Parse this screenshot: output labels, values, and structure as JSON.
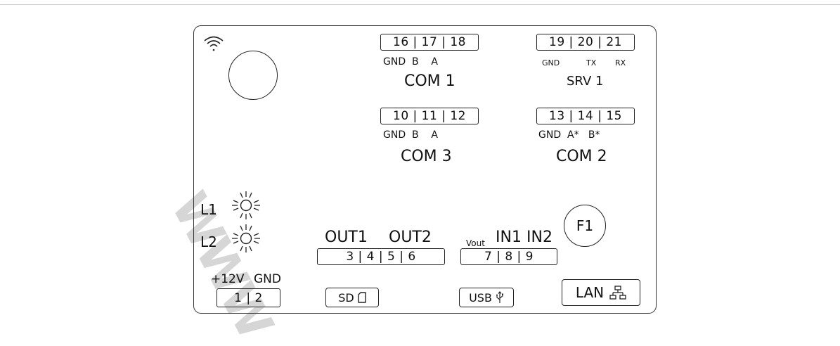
{
  "terminals": {
    "com1_pins": "16 | 17 | 18",
    "srv1_pins": "19 | 20 | 21",
    "com3_pins": "10 | 11 | 12",
    "com2_pins": "13 | 14 | 15",
    "out_pins": "3 | 4 | 5 | 6",
    "in_pins": "7 | 8 | 9",
    "power_pins": "1 | 2"
  },
  "signals": {
    "com1": "GND  B    A",
    "srv1": [
      "GND",
      "TX",
      "RX"
    ],
    "com3": "GND  B    A",
    "com2": "GND  A*   B*"
  },
  "ports": {
    "com1": "COM 1",
    "srv1": "SRV 1",
    "com3": "COM 3",
    "com2": "COM 2"
  },
  "leds": {
    "l1": "L1",
    "l2": "L2"
  },
  "outputs": {
    "out1": "OUT1",
    "out2": "OUT2"
  },
  "inputs": {
    "vout": "Vout",
    "in1": "IN1",
    "in2": "IN2"
  },
  "power": {
    "v12": "+12V",
    "gnd": "GND"
  },
  "function_button": "F1",
  "sd_label": "SD",
  "usb_label": "USB",
  "lan_label": "LAN",
  "watermark": "WWW",
  "icons": [
    "wifi-icon",
    "led-light-icon",
    "sd-card-icon",
    "usb-icon",
    "lan-network-icon"
  ]
}
